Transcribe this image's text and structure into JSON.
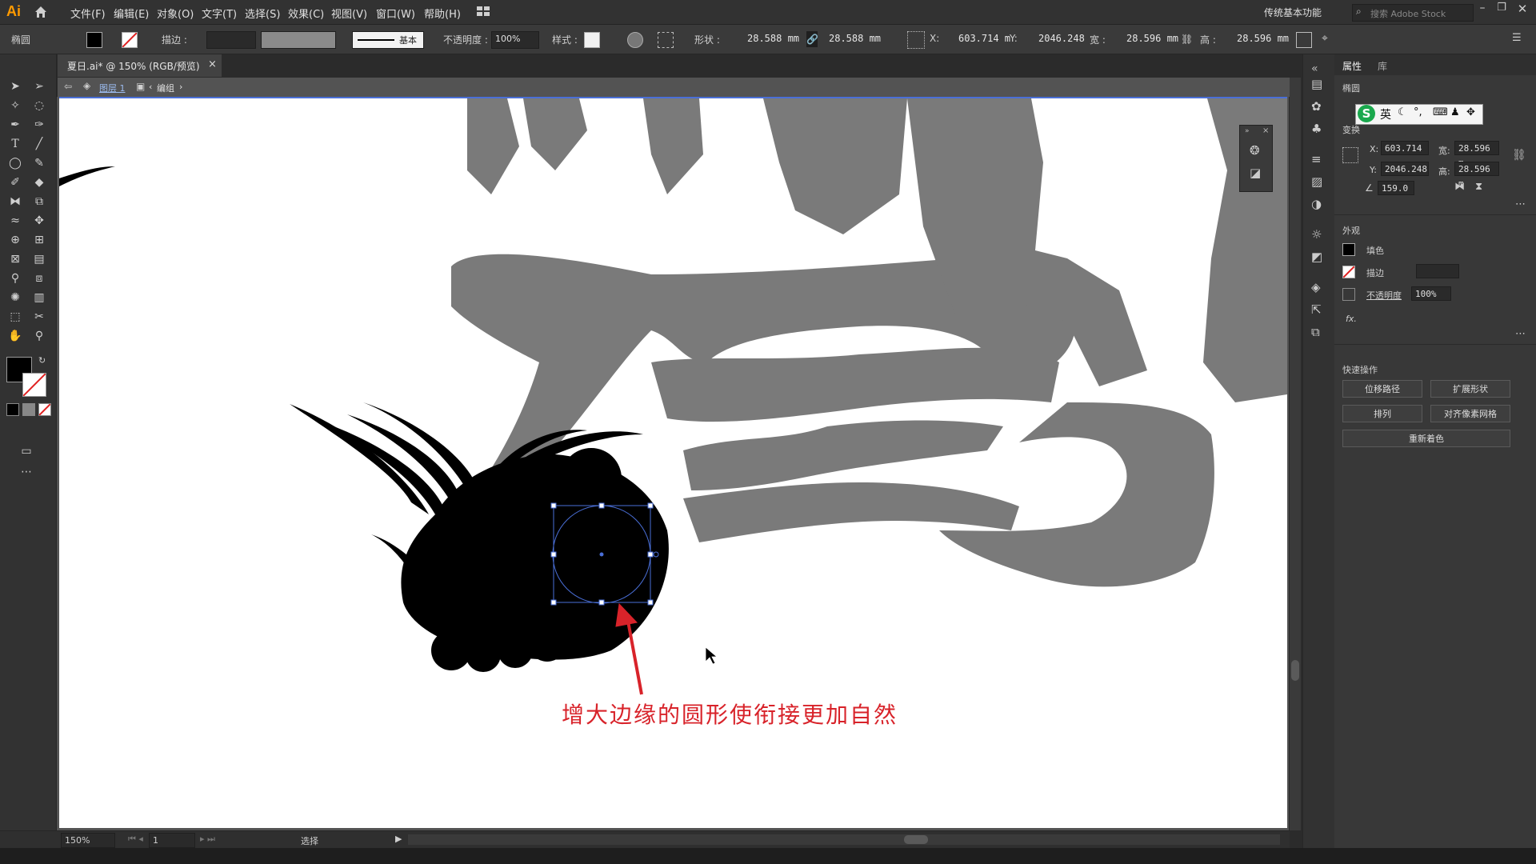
{
  "app": {
    "logo": "Ai",
    "workspace": "传统基本功能",
    "search_placeholder": "搜索 Adobe Stock"
  },
  "menu": [
    "文件(F)",
    "编辑(E)",
    "对象(O)",
    "文字(T)",
    "选择(S)",
    "效果(C)",
    "视图(V)",
    "窗口(W)",
    "帮助(H)"
  ],
  "control_bar": {
    "object_type": "椭圆",
    "stroke_label": "描边 :",
    "brush_label": "基本",
    "opacity_label": "不透明度 :",
    "opacity_value": "100%",
    "style_label": "样式 :",
    "shape_label": "形状 :",
    "shape_w": "28.588 mm",
    "shape_h": "28.588 mm",
    "x_label": "X:",
    "x_value": "603.714 m",
    "y_label": "Y:",
    "y_value": "2046.248",
    "w_label": "宽 :",
    "w_value": "28.596 mm",
    "h_label": "高 :",
    "h_value": "28.596 mm"
  },
  "document": {
    "tab_title": "夏日.ai* @ 150% (RGB/预览)",
    "close": "×"
  },
  "breadcrumb": {
    "layer": "图层 1",
    "group": "编组"
  },
  "annotation": {
    "text": "增大边缘的圆形使衔接更加自然"
  },
  "panel": {
    "tabs": [
      "属性",
      "库"
    ],
    "section_object": "椭圆",
    "section_transform": "变换",
    "x_label": "X:",
    "x_value": "603.714",
    "y_label": "Y:",
    "y_value": "2046.248",
    "w_label": "宽:",
    "w_value": "28.596 m",
    "h_label": "高:",
    "h_value": "28.596 m",
    "angle_value": "159.0",
    "section_appearance": "外观",
    "fill_label": "填色",
    "stroke_label": "描边",
    "opacity_label": "不透明度",
    "opacity_value": "100%",
    "fx_label": "fx.",
    "section_quick": "快速操作",
    "btn_offset": "位移路径",
    "btn_expand": "扩展形状",
    "btn_arrange": "排列",
    "btn_align_pixel": "对齐像素网格",
    "btn_recolor": "重新着色",
    "ime_lang": "英"
  },
  "status": {
    "zoom": "150%",
    "page": "1",
    "tool": "选择"
  },
  "colors": {
    "accent_orange": "#ff9a00",
    "annotation_red": "#d8232a",
    "selection_blue": "#4a6fd8",
    "grey_char": "#7a7a7a"
  }
}
